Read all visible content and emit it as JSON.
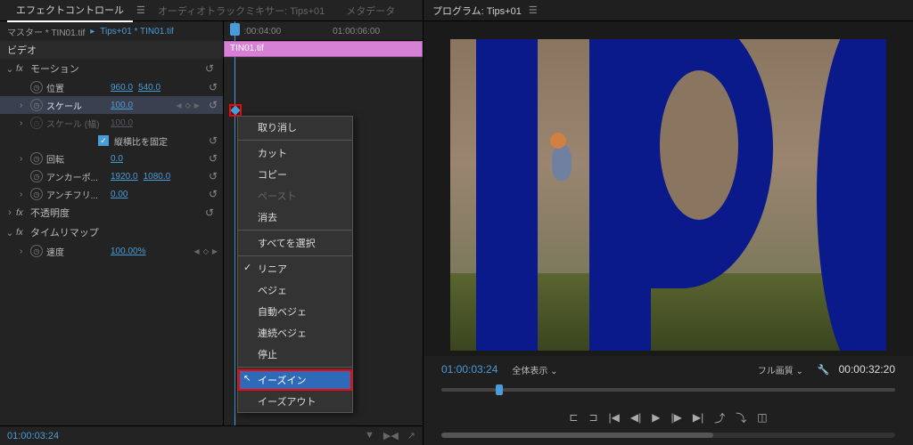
{
  "tabs": {
    "effect_controls": "エフェクトコントロール",
    "audio_mixer": "オーディオトラックミキサー: Tips+01",
    "metadata": "メタデータ"
  },
  "breadcrumb": {
    "master": "マスター * TIN01.tif",
    "current": "Tips+01 * TIN01.tif"
  },
  "ruler_times": {
    "t1": ":00:04:00",
    "t2": "01:00:06:00"
  },
  "section_video": "ビデオ",
  "fx": {
    "motion": "モーション",
    "opacity": "不透明度",
    "timeremap": "タイムリマップ"
  },
  "props": {
    "position": {
      "label": "位置",
      "x": "960.0",
      "y": "540.0"
    },
    "scale": {
      "label": "スケール",
      "val": "100.0"
    },
    "scale_w": {
      "label": "スケール (幅)",
      "val": "100.0"
    },
    "lock_aspect": "縦横比を固定",
    "rotation": {
      "label": "回転",
      "val": "0.0"
    },
    "anchor": {
      "label": "アンカーポ...",
      "x": "1920.0",
      "y": "1080.0"
    },
    "antiflicker": {
      "label": "アンチフリ...",
      "val": "0.00"
    },
    "speed": {
      "label": "速度",
      "val": "100.00%"
    }
  },
  "clip_name": "TIN01.tif",
  "context_menu": {
    "undo": "取り消し",
    "cut": "カット",
    "copy": "コピー",
    "paste": "ペースト",
    "clear": "消去",
    "select_all": "すべてを選択",
    "linear": "リニア",
    "bezier": "ベジェ",
    "auto_bezier": "自動ベジェ",
    "cont_bezier": "連続ベジェ",
    "hold": "停止",
    "ease_in": "イーズイン",
    "ease_out": "イーズアウト"
  },
  "playhead_time": "01:00:03:24",
  "program": {
    "title": "プログラム: Tips+01",
    "time": "01:00:03:24",
    "fit": "全体表示",
    "quality": "フル画質",
    "duration": "00:00:32:20"
  }
}
